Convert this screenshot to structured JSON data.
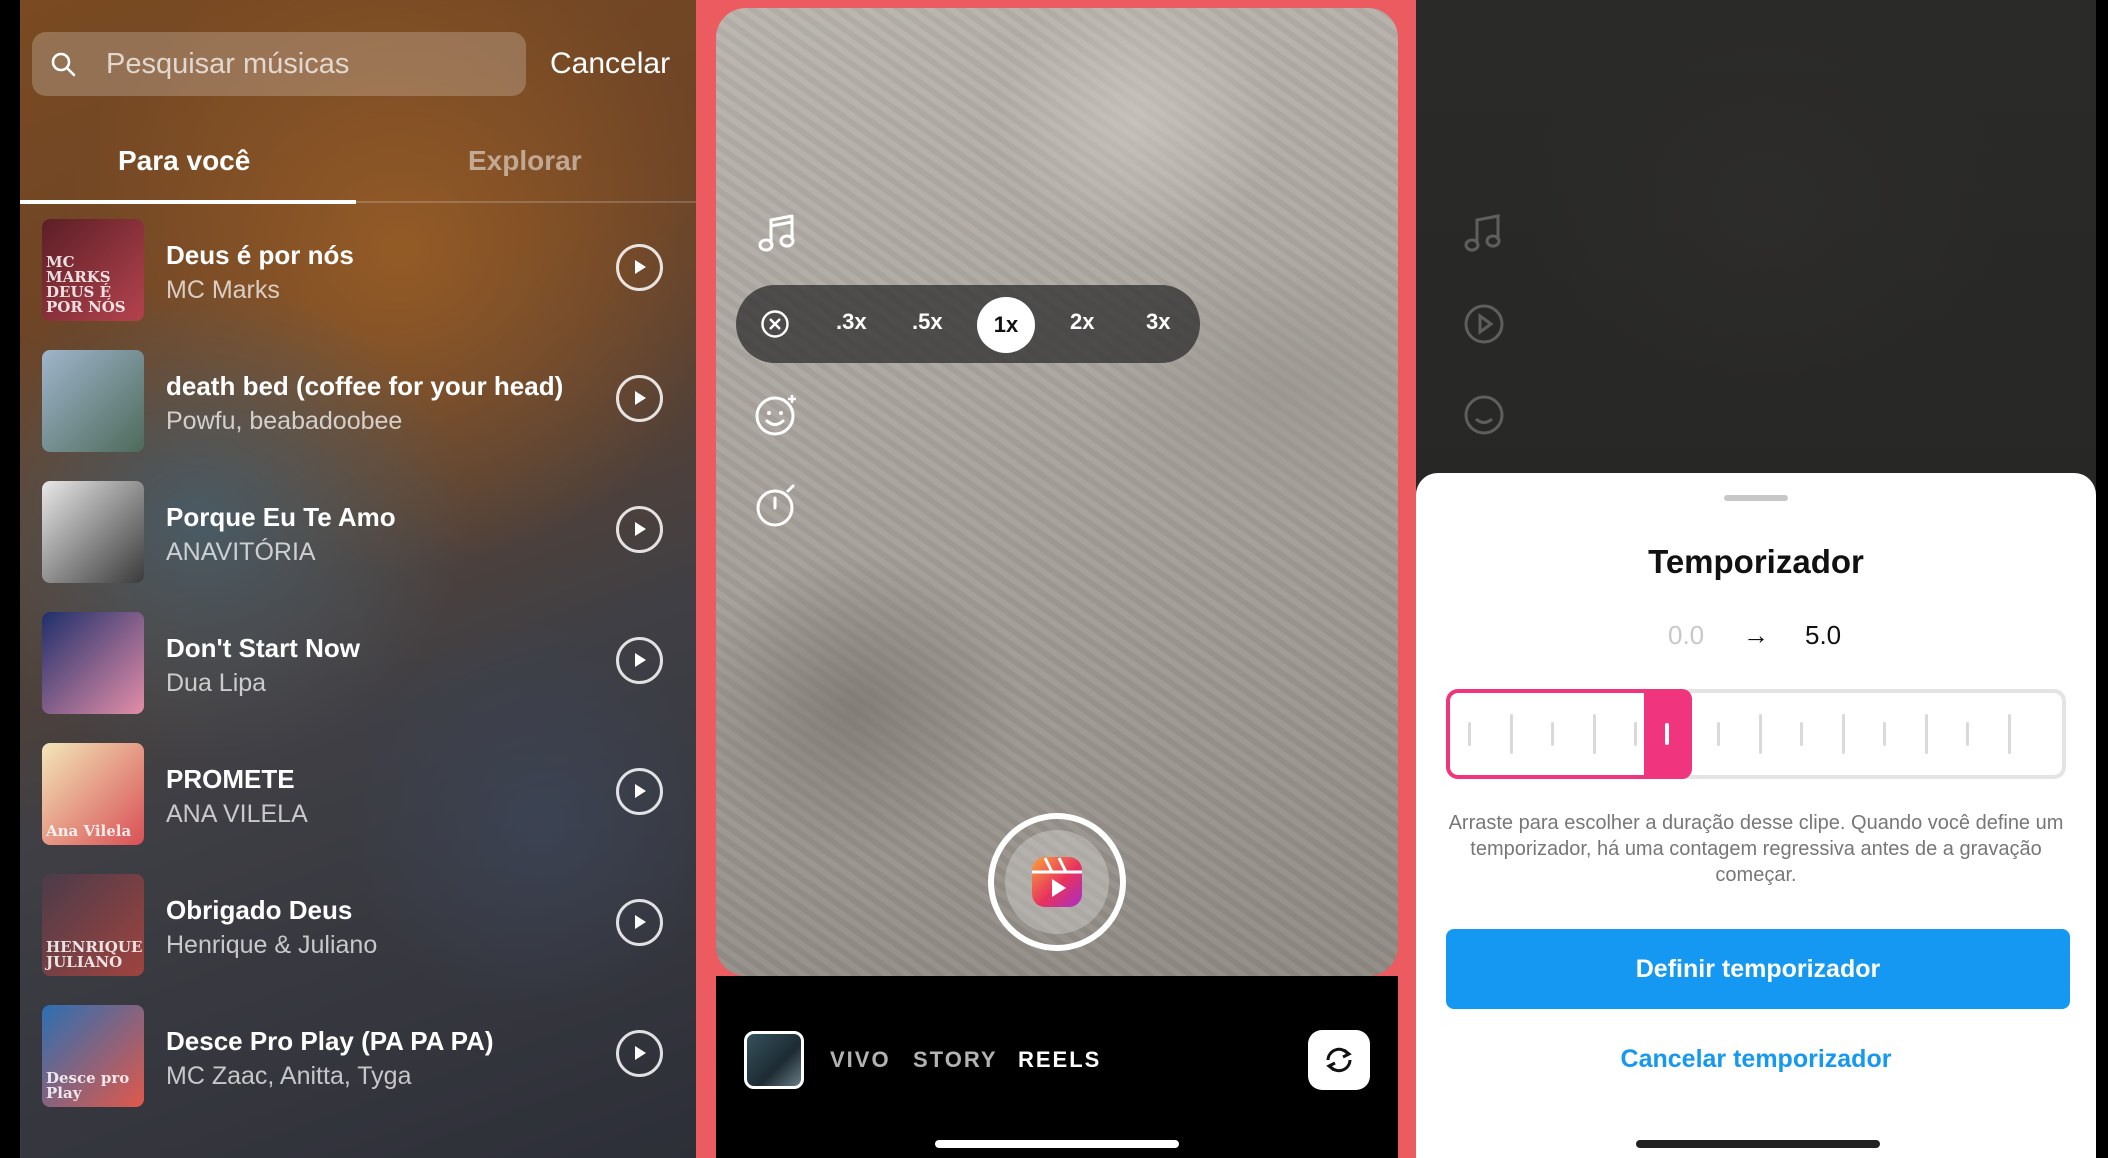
{
  "music_picker": {
    "search": {
      "placeholder": "Pesquisar músicas"
    },
    "cancel_label": "Cancelar",
    "tabs": [
      {
        "label": "Para você",
        "active": true
      },
      {
        "label": "Explorar",
        "active": false
      }
    ],
    "songs": [
      {
        "title": "Deus é por nós",
        "artist": "MC Marks",
        "art_caption": "MC MARKS DEUS É POR NÓS",
        "art_colors": [
          "#5c1e26",
          "#b4434e"
        ]
      },
      {
        "title": "death bed (coffee for your head)",
        "artist": "Powfu, beabadoobee",
        "art_caption": "",
        "art_colors": [
          "#9fb5cc",
          "#4e6a5a"
        ]
      },
      {
        "title": "Porque Eu Te Amo",
        "artist": "ANAVITÓRIA",
        "art_caption": "",
        "art_colors": [
          "#e8e8e8",
          "#3a3a3a"
        ]
      },
      {
        "title": "Don't Start Now",
        "artist": "Dua Lipa",
        "art_caption": "",
        "art_colors": [
          "#1f2f6b",
          "#e38ea8"
        ]
      },
      {
        "title": "PROMETE",
        "artist": "ANA VILELA",
        "art_caption": "Ana Vilela",
        "art_colors": [
          "#f2e7b8",
          "#d94f55"
        ]
      },
      {
        "title": "Obrigado Deus",
        "artist": "Henrique & Juliano",
        "art_caption": "HENRIQUE JULIANO",
        "art_colors": [
          "#4b3b4a",
          "#a0443f"
        ]
      },
      {
        "title": "Desce Pro Play (PA PA PA)",
        "artist": "MC Zaac, Anitta, Tyga",
        "art_caption": "Desce pro Play",
        "art_colors": [
          "#2b6fb3",
          "#e1584a"
        ]
      }
    ]
  },
  "camera": {
    "speeds": [
      {
        "label": ".3x",
        "selected": false
      },
      {
        "label": ".5x",
        "selected": false
      },
      {
        "label": "1x",
        "selected": true
      },
      {
        "label": "2x",
        "selected": false
      },
      {
        "label": "3x",
        "selected": false
      }
    ],
    "modes": [
      "VIVO",
      "STORY",
      "REELS"
    ],
    "active_mode": "REELS",
    "colors": {
      "frame": "#ec5b5f",
      "record_gradient": [
        "#f9a23b",
        "#e8325d",
        "#a72ec9"
      ]
    }
  },
  "timer_sheet": {
    "title": "Temporizador",
    "range_start": "0.0",
    "range_arrow": "→",
    "range_end": "5.0",
    "selected_fraction": 0.33,
    "description": "Arraste para escolher a duração desse clipe. Quando você define um temporizador, há uma contagem regressiva antes de a gravação começar.",
    "primary_button": "Definir temporizador",
    "secondary_button": "Cancelar temporizador",
    "colors": {
      "accent": "#f0357e",
      "button": "#1498f1"
    }
  }
}
